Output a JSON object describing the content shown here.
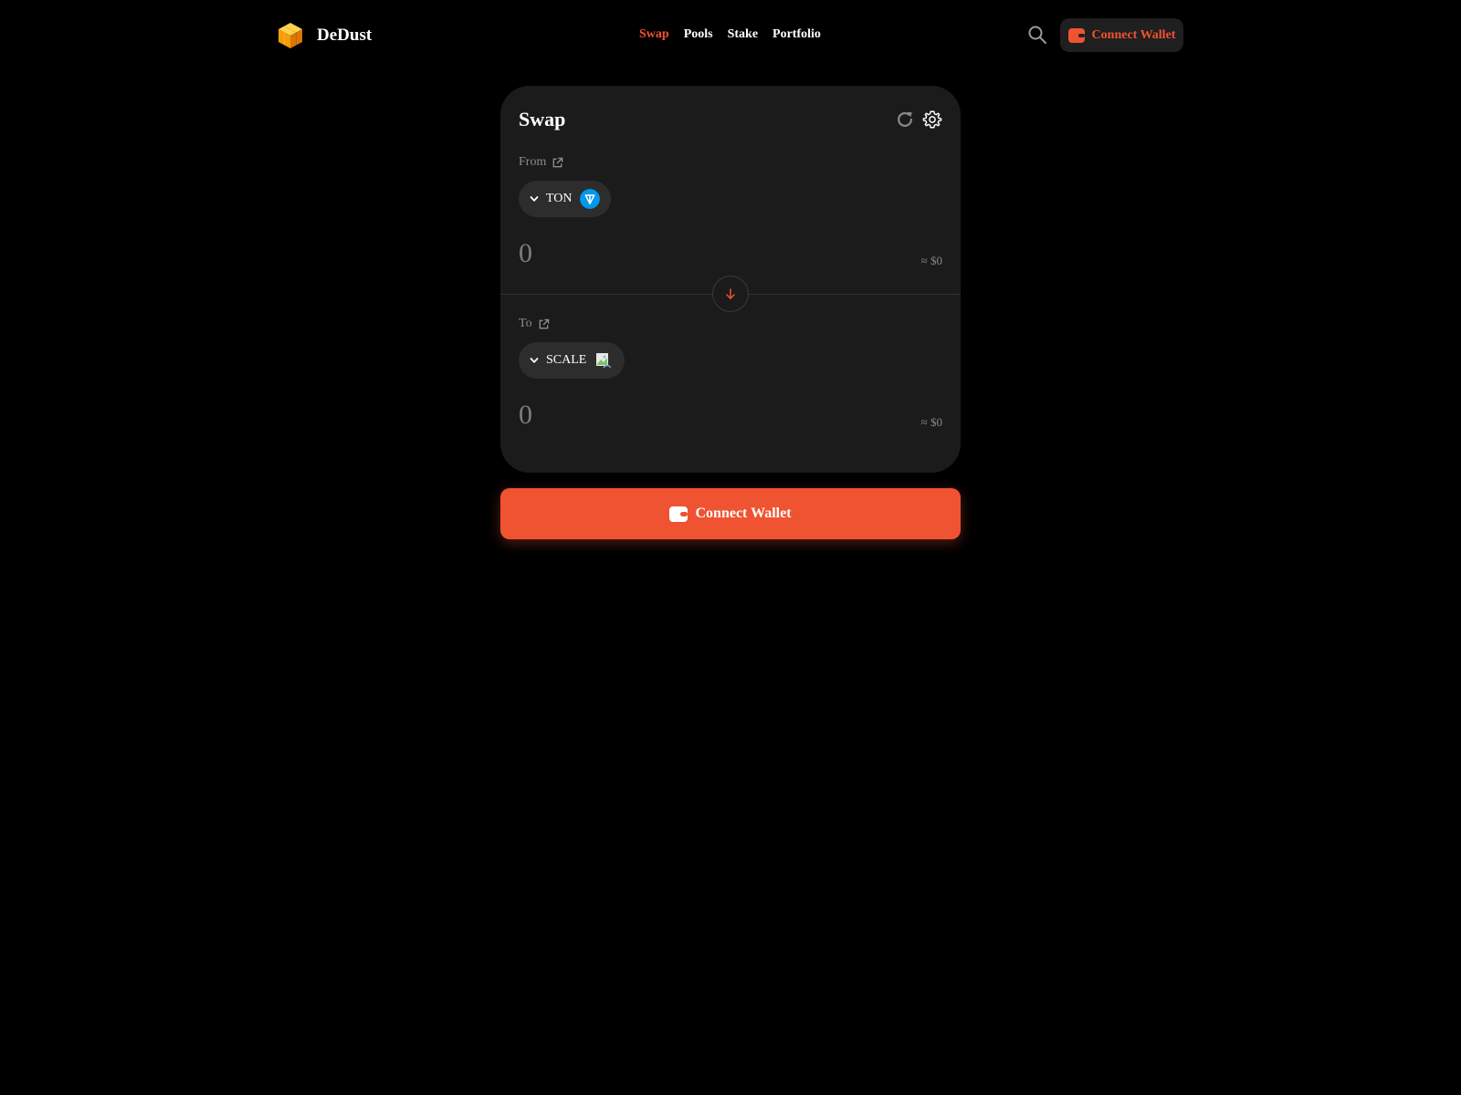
{
  "brand": {
    "name": "DeDust",
    "logo_icon": "cube-logo-icon",
    "accent_color": "#ef5331"
  },
  "nav": {
    "items": [
      {
        "label": "Swap",
        "active": true
      },
      {
        "label": "Pools",
        "active": false
      },
      {
        "label": "Stake",
        "active": false
      },
      {
        "label": "Portfolio",
        "active": false
      }
    ]
  },
  "header": {
    "search_icon": "search-icon",
    "connect_wallet_label": "Connect Wallet"
  },
  "swap": {
    "title": "Swap",
    "refresh_icon": "refresh-icon",
    "settings_icon": "gear-icon",
    "from": {
      "label": "From",
      "token": "TON",
      "token_icon": "ton-token-icon",
      "amount_placeholder": "0",
      "usd_value": "≈ $0"
    },
    "to": {
      "label": "To",
      "token": "SCALE",
      "token_icon": "scale-token-icon",
      "amount_placeholder": "0",
      "usd_value": "≈ $0"
    },
    "direction_icon": "arrow-down-icon"
  },
  "main_button": {
    "label": "Connect Wallet",
    "icon": "wallet-icon"
  }
}
